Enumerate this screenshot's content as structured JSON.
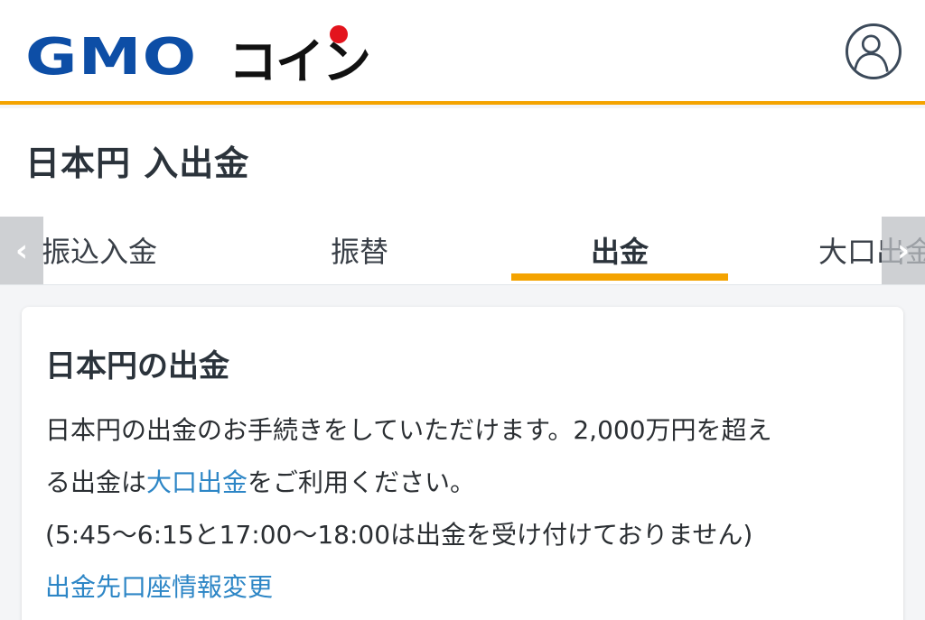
{
  "header": {
    "logo_text": "GMO",
    "logo_text_jp": "コイン",
    "user_icon": "user-icon"
  },
  "page": {
    "title": "日本円 入出金"
  },
  "tabs": {
    "items": [
      {
        "label": "振込入金"
      },
      {
        "label": "振替"
      },
      {
        "label": "出金",
        "active": true
      },
      {
        "label": "大口出金"
      }
    ],
    "prev_icon": "chevron-left-icon",
    "next_icon": "chevron-right-icon",
    "prev_glyph": "‹",
    "next_glyph": "›",
    "accent_color": "#f4a300"
  },
  "card": {
    "title": "日本円の出金",
    "line1": "日本円の出金のお手続きをしていただけます。2,000万円を超え",
    "line2_pre": "る出金は",
    "line2_link": "大口出金",
    "line2_post": "をご利用ください。",
    "line3": "(5:45〜6:15と17:00〜18:00は出金を受け付けておりません)",
    "change_link": "出金先口座情報変更"
  },
  "colors": {
    "brand_blue": "#0d4ea6",
    "brand_red": "#e3141d",
    "link_blue": "#2d86c6"
  }
}
